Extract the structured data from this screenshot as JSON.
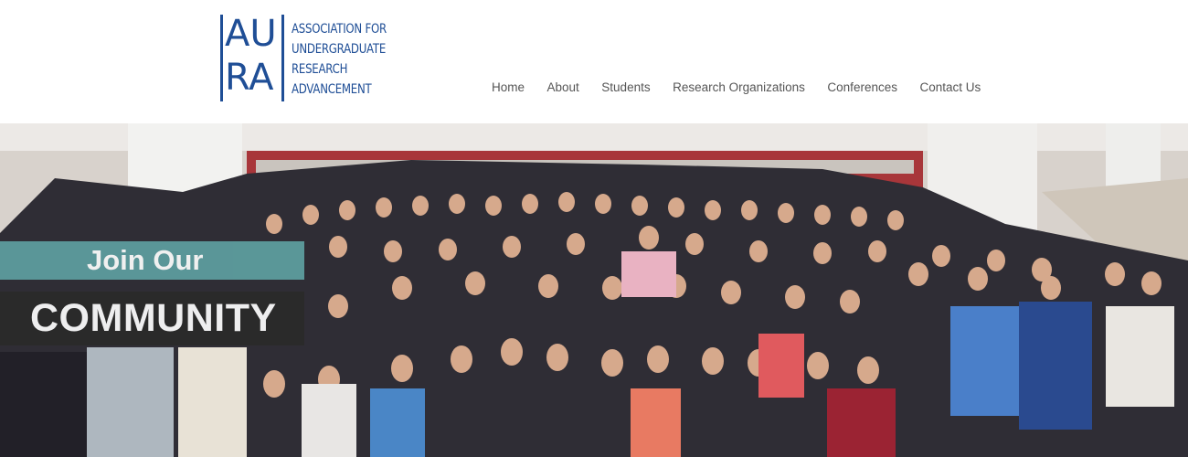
{
  "logo": {
    "letters": [
      "AU",
      "RA"
    ],
    "text_lines": [
      "ASSOCIATION FOR",
      "UNDERGRADUATE",
      "RESEARCH",
      "ADVANCEMENT"
    ],
    "color": "#1f4e96"
  },
  "nav": {
    "items": [
      {
        "label": "Home"
      },
      {
        "label": "About"
      },
      {
        "label": "Students"
      },
      {
        "label": "Research Organizations"
      },
      {
        "label": "Conferences"
      },
      {
        "label": "Contact Us"
      }
    ]
  },
  "hero": {
    "banner_line1": "Join Our",
    "banner_line2": "COMMUNITY",
    "banner_line1_color": "#5e9fa0",
    "banner_line2_color": "#2a2a2a"
  }
}
